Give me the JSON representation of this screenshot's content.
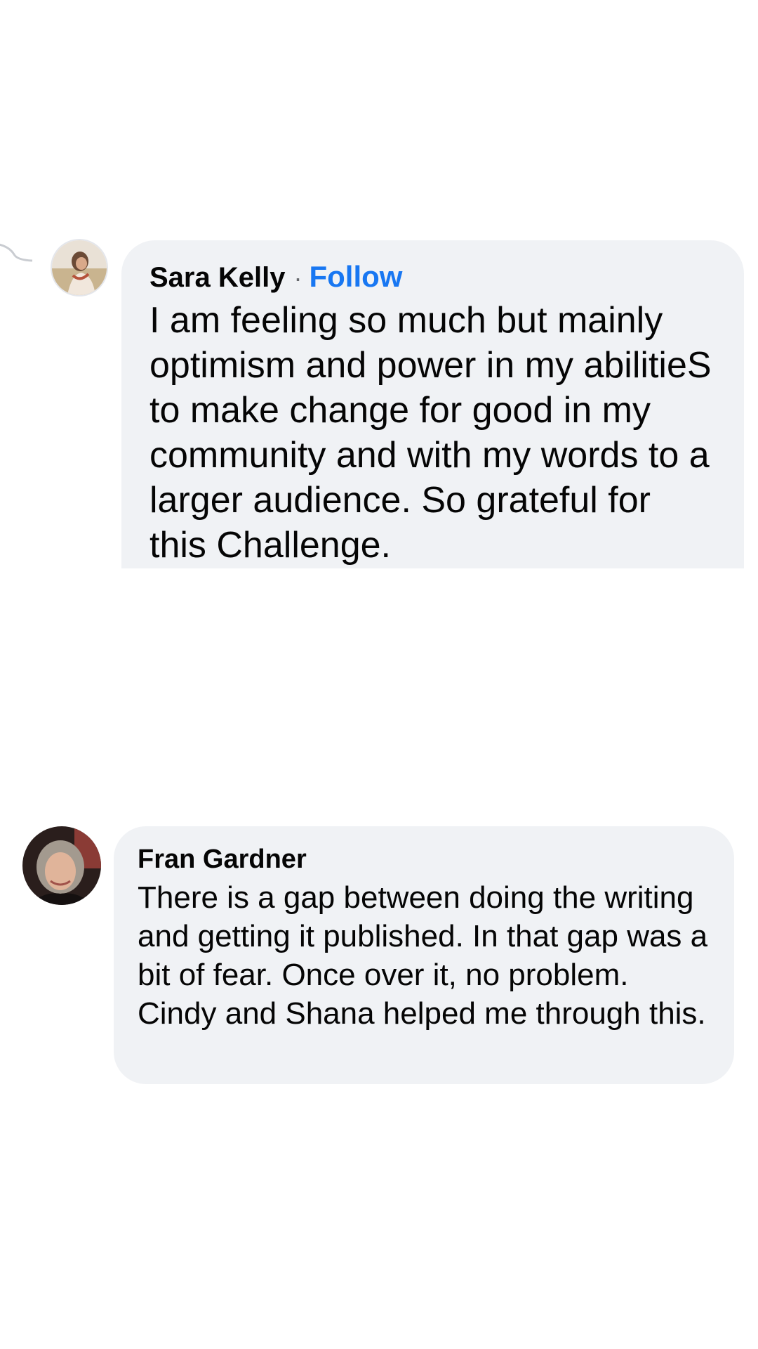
{
  "comments": [
    {
      "author": "Sara Kelly",
      "separator": "·",
      "follow_label": "Follow",
      "text": "I am feeling so much but mainly optimism and power in my abilitieS to make change for good in my community and with my words to a larger audience. So grateful for this Challenge."
    },
    {
      "author": "Fran Gardner",
      "text": "There is a gap between doing the writing and getting it published. In that gap was a bit of fear. Once over it, no problem. Cindy and Shana helped me through this."
    }
  ],
  "colors": {
    "bubble": "#f0f2f5",
    "follow": "#1877f2",
    "text": "#050505",
    "thread_line": "#c9ccd1"
  }
}
